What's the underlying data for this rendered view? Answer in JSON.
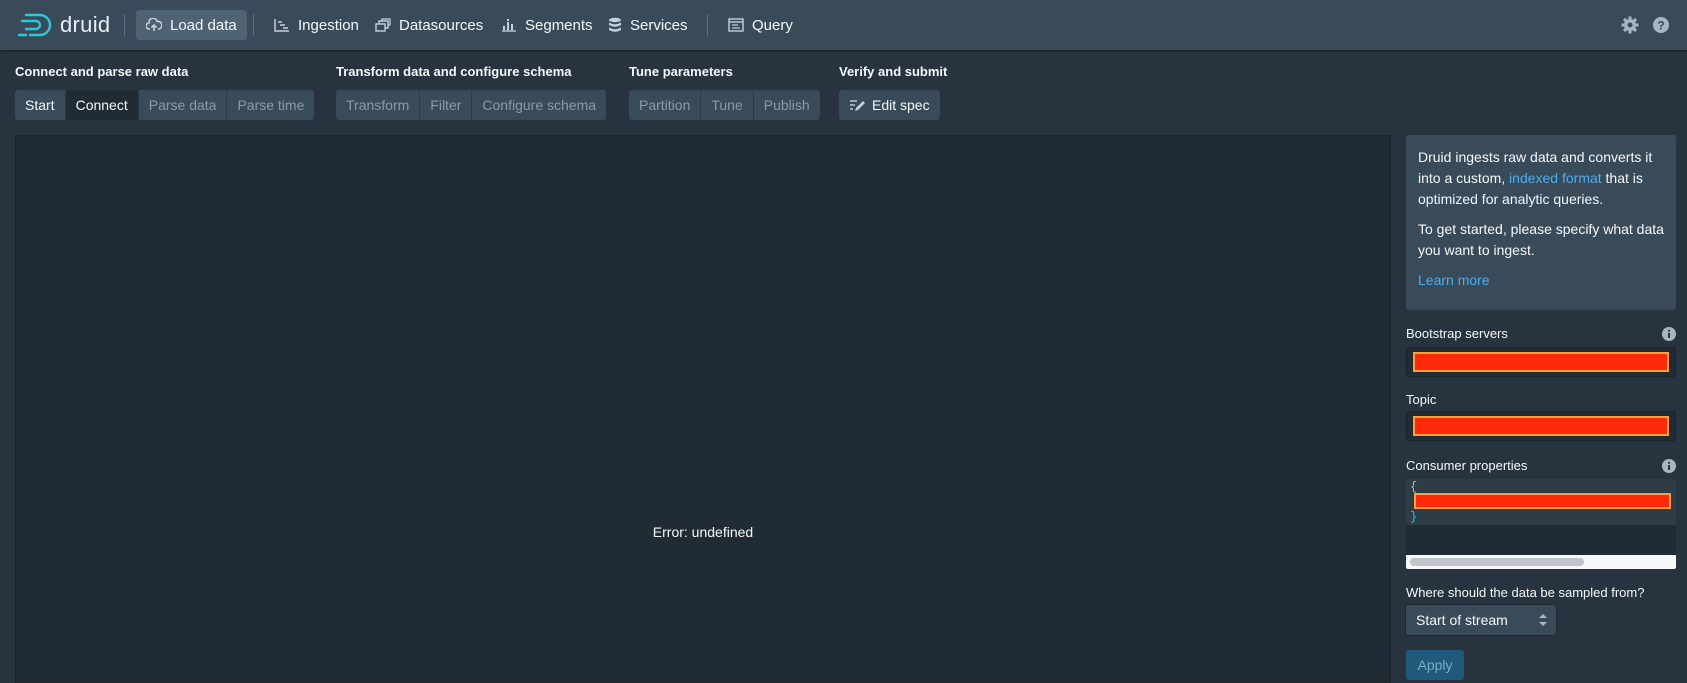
{
  "app": {
    "name": "druid"
  },
  "nav": {
    "load_data": "Load data",
    "ingestion": "Ingestion",
    "datasources": "Datasources",
    "segments": "Segments",
    "services": "Services",
    "query": "Query"
  },
  "steps": {
    "connect_group": {
      "title": "Connect and parse raw data",
      "items": [
        "Start",
        "Connect",
        "Parse data",
        "Parse time"
      ]
    },
    "transform_group": {
      "title": "Transform data and configure schema",
      "items": [
        "Transform",
        "Filter",
        "Configure schema"
      ]
    },
    "tune_group": {
      "title": "Tune parameters",
      "items": [
        "Partition",
        "Tune",
        "Publish"
      ]
    },
    "verify_group": {
      "title": "Verify and submit",
      "items": [
        "Edit spec"
      ]
    }
  },
  "main": {
    "error": "Error: undefined"
  },
  "info": {
    "p1_before": "Druid ingests raw data and converts it into a custom, ",
    "p1_link": "indexed format",
    "p1_after": " that is optimized for analytic queries.",
    "p2": "To get started, please specify what data you want to ingest.",
    "learn_more": "Learn more"
  },
  "form": {
    "bootstrap_label": "Bootstrap servers",
    "topic_label": "Topic",
    "consumer_label": "Consumer properties",
    "code_open": "{",
    "code_close": "}",
    "sample_label": "Where should the data be sampled from?",
    "sample_value": "Start of stream",
    "apply": "Apply"
  },
  "colors": {
    "accent": "#48aff0",
    "header_bg": "#394b59",
    "body_bg": "#27333e",
    "redaction": "#ff2a0a"
  }
}
